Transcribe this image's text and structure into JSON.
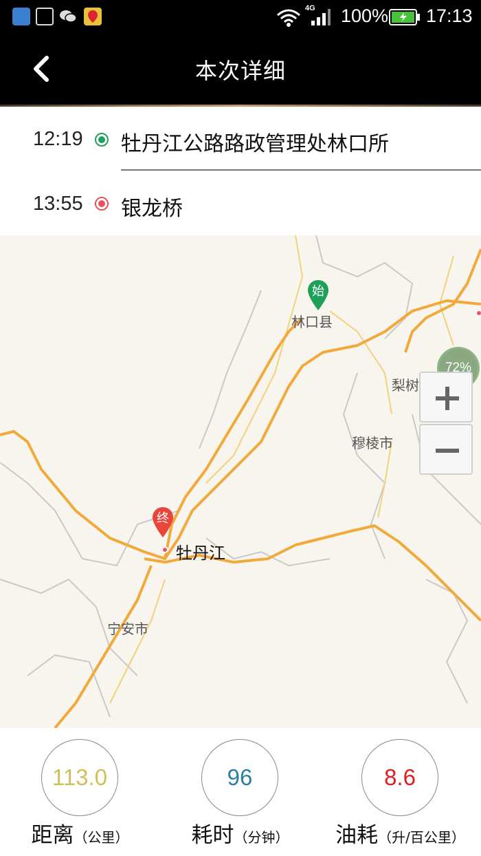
{
  "status_bar": {
    "battery_percent": "100%",
    "time": "17:13",
    "network": "4G"
  },
  "header": {
    "title": "本次详细",
    "back_icon": "chevron-left-icon"
  },
  "route": {
    "start": {
      "time": "12:19",
      "name": "牡丹江公路路政管理处林口所"
    },
    "end": {
      "time": "13:55",
      "name": "银龙桥"
    }
  },
  "map": {
    "labels": {
      "linkou": "林口县",
      "lishu": "梨树区",
      "muling": "穆棱市",
      "mudanjiang": "牡丹江",
      "ningan": "宁安市"
    },
    "start_marker": "始",
    "end_marker": "终",
    "loading_progress": "72%",
    "zoom_in_icon": "plus-icon",
    "zoom_out_icon": "minus-icon"
  },
  "stats": {
    "distance": {
      "value": "113.0",
      "label": "距离",
      "unit": "（公里）",
      "color": "#cfc05a"
    },
    "duration": {
      "value": "96",
      "label": "耗时",
      "unit": "（分钟）",
      "color": "#2a7fa0"
    },
    "fuel": {
      "value": "8.6",
      "label": "油耗",
      "unit": "（升/百公里）",
      "color": "#e02020"
    }
  },
  "colors": {
    "start_green": "#1ea05a",
    "end_red": "#e8545a",
    "road_orange": "#f2a93b"
  }
}
